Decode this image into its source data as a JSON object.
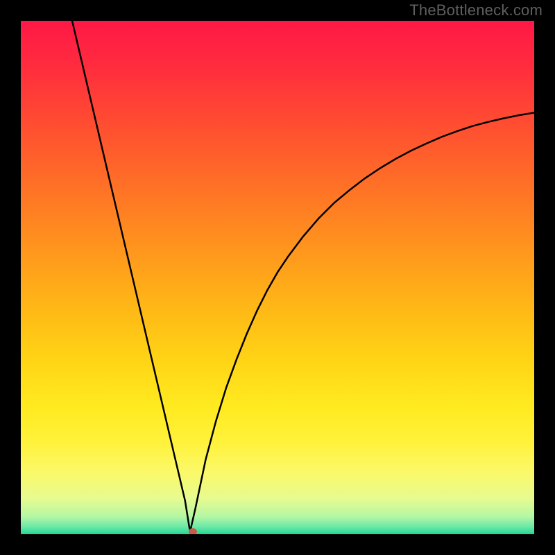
{
  "watermark": "TheBottleneck.com",
  "colors": {
    "page_bg": "#000000",
    "watermark_text": "#5f5f5f",
    "curve_stroke": "#000000",
    "dot_fill": "#cc5a4a",
    "gradient_stops": [
      {
        "offset": 0.0,
        "color": "#ff1846"
      },
      {
        "offset": 0.08,
        "color": "#ff2a3f"
      },
      {
        "offset": 0.18,
        "color": "#ff4733"
      },
      {
        "offset": 0.3,
        "color": "#ff6a28"
      },
      {
        "offset": 0.42,
        "color": "#ff8e1f"
      },
      {
        "offset": 0.54,
        "color": "#ffb217"
      },
      {
        "offset": 0.66,
        "color": "#ffd415"
      },
      {
        "offset": 0.75,
        "color": "#ffea20"
      },
      {
        "offset": 0.82,
        "color": "#fff23a"
      },
      {
        "offset": 0.88,
        "color": "#fbf96a"
      },
      {
        "offset": 0.93,
        "color": "#e7fb8f"
      },
      {
        "offset": 0.965,
        "color": "#b6f7a4"
      },
      {
        "offset": 0.985,
        "color": "#6ee9a8"
      },
      {
        "offset": 1.0,
        "color": "#1fd893"
      }
    ]
  },
  "chart_data": {
    "type": "line",
    "title": "",
    "xlabel": "",
    "ylabel": "",
    "xlim": [
      0,
      100
    ],
    "ylim": [
      0,
      100
    ],
    "grid": false,
    "x_valley": 33,
    "dot": {
      "x": 33.5,
      "y": 0.5
    },
    "series": [
      {
        "name": "curve",
        "x": [
          10,
          12,
          14,
          16,
          18,
          20,
          22,
          24,
          26,
          28,
          30,
          32,
          32.8,
          33,
          33.2,
          34,
          36,
          38,
          40,
          42,
          44,
          46,
          48,
          50,
          52,
          55,
          58,
          61,
          64,
          67,
          70,
          73,
          76,
          79,
          82,
          85,
          88,
          91,
          94,
          97,
          100
        ],
        "y": [
          100,
          91.5,
          83,
          74.5,
          66,
          57.5,
          49,
          40.5,
          32,
          23.5,
          15,
          6.5,
          1.5,
          0.5,
          1.5,
          5,
          14.5,
          22,
          28.5,
          34,
          39,
          43.5,
          47.5,
          51,
          54,
          58,
          61.5,
          64.5,
          67,
          69.3,
          71.3,
          73.1,
          74.7,
          76.1,
          77.4,
          78.5,
          79.5,
          80.3,
          81,
          81.6,
          82.1
        ]
      }
    ]
  }
}
